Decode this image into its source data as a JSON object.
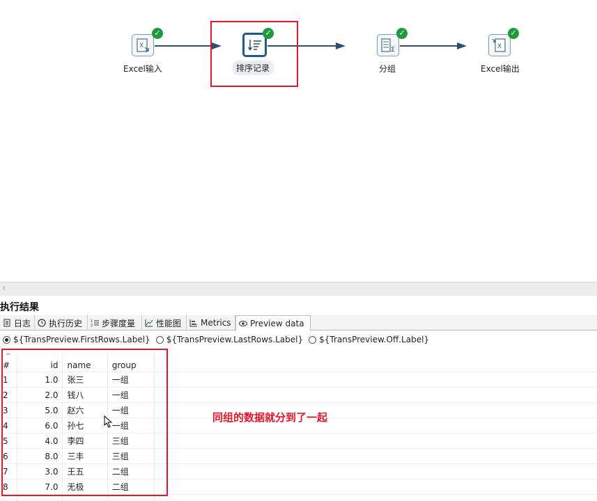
{
  "canvas": {
    "steps": [
      {
        "label": "Excel输入",
        "icon": "excel-input-icon"
      },
      {
        "label": "排序记录",
        "icon": "sort-rows-icon"
      },
      {
        "label": "分组",
        "icon": "group-by-icon"
      },
      {
        "label": "Excel输出",
        "icon": "excel-output-icon"
      }
    ],
    "status_icon": "success-check-icon",
    "highlight_color": "#e0182c"
  },
  "results": {
    "title": "执行结果",
    "tabs": [
      {
        "label": "日志",
        "icon": "log-icon"
      },
      {
        "label": "执行历史",
        "icon": "history-icon"
      },
      {
        "label": "步骤度量",
        "icon": "step-metrics-icon"
      },
      {
        "label": "性能图",
        "icon": "performance-graph-icon"
      },
      {
        "label": "Metrics",
        "icon": "metrics-icon"
      },
      {
        "label": "Preview data",
        "icon": "eye-icon"
      }
    ],
    "active_tab": "Preview data",
    "radio_options": [
      {
        "label": "${TransPreview.FirstRows.Label}",
        "selected": true
      },
      {
        "label": "${TransPreview.LastRows.Label}",
        "selected": false
      },
      {
        "label": "${TransPreview.Off.Label}",
        "selected": false
      }
    ],
    "table": {
      "columns": [
        "#",
        "id",
        "name",
        "group"
      ],
      "rows": [
        [
          "1",
          "1.0",
          "张三",
          "一组"
        ],
        [
          "2",
          "2.0",
          "钱八",
          "一组"
        ],
        [
          "3",
          "5.0",
          "赵六",
          "一组"
        ],
        [
          "4",
          "6.0",
          "孙七",
          "一组"
        ],
        [
          "5",
          "4.0",
          "李四",
          "三组"
        ],
        [
          "6",
          "8.0",
          "三丰",
          "三组"
        ],
        [
          "7",
          "3.0",
          "王五",
          "二组"
        ],
        [
          "8",
          "7.0",
          "无极",
          "二组"
        ]
      ]
    },
    "annotation": "同组的数据就分到了一起"
  }
}
